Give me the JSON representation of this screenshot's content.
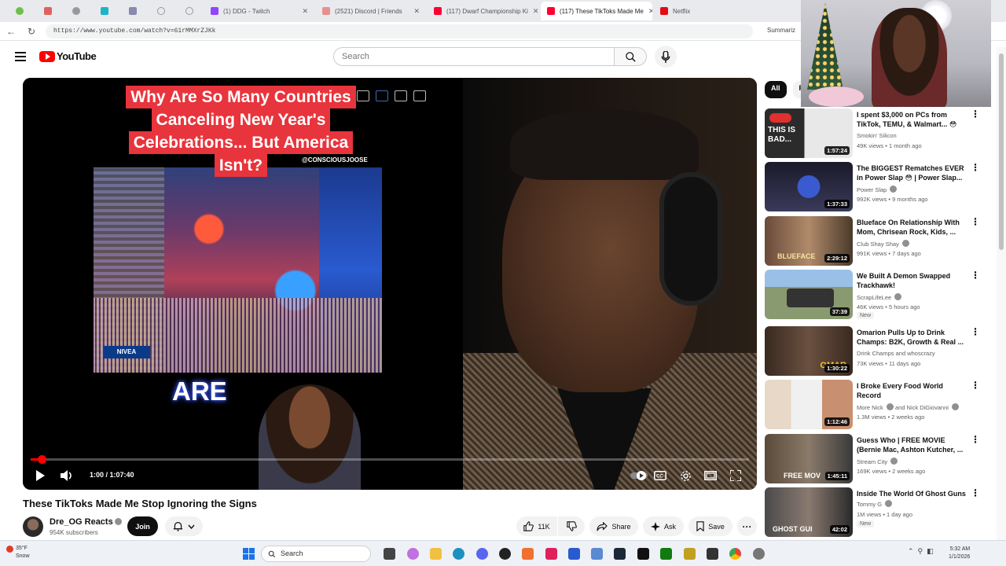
{
  "browser": {
    "tabs": [
      {
        "label": "(1) DDG - Twitch",
        "fav_color": "#9146ff"
      },
      {
        "label": "(2521) Discord | Friends",
        "fav_color": "#e8908e"
      },
      {
        "label": "(117) Dwarf Championship Ki",
        "fav_color": "#ff0033"
      },
      {
        "label": "(117) These TikToks Made Me",
        "fav_color": "#ff0033",
        "active": true
      },
      {
        "label": "Netflix",
        "fav_color": "#e50914"
      }
    ],
    "url": "https://www.youtube.com/watch?v=61rMMXrZJKk",
    "summarize": "Summariz"
  },
  "youtube": {
    "logo_text": "YouTube",
    "search_placeholder": "Search"
  },
  "player": {
    "overlay_caption": [
      "Why Are So Many Countries",
      "Canceling New Year's",
      "Celebrations... But America",
      "Isn't?"
    ],
    "overlay_handle": "@CONSCIOUSJOOSE",
    "overlay_word": "ARE",
    "sign_text": "NIVEA",
    "time_display": "1:00 / 1:07:40",
    "progress_fraction": 0.015
  },
  "video": {
    "title": "These TikToks Made Me Stop Ignoring the Signs",
    "channel": "Dre_OG Reacts",
    "subscribers": "954K subscribers",
    "join_label": "Join",
    "likes": "11K",
    "share_label": "Share",
    "ask_label": "Ask",
    "save_label": "Save"
  },
  "chips": [
    "All",
    "F"
  ],
  "recommendations": [
    {
      "title": "I spent $3,000 on PCs from TikTok, TEMU, & Walmart... 😳",
      "channel": "Smokin' Silicon",
      "meta": "49K views • 1 month ago",
      "duration": "1:57:24",
      "thumb_text": "THIS IS BAD...",
      "verified": false,
      "badge": ""
    },
    {
      "title": "The BIGGEST Rematches EVER in Power Slap 😳 | Power Slap...",
      "channel": "Power Slap",
      "meta": "992K views • 9 months ago",
      "duration": "1:37:33",
      "thumb_text": "",
      "verified": true,
      "badge": ""
    },
    {
      "title": "Blueface On Relationship With Mom, Chrisean Rock, Kids, ...",
      "channel": "Club Shay Shay",
      "meta": "991K views • 7 days ago",
      "duration": "2:29:12",
      "thumb_text": "BLUEFACE",
      "verified": true,
      "badge": ""
    },
    {
      "title": "We Built A Demon Swapped Trackhawk!",
      "channel": "ScrapLifeLee",
      "meta": "46K views • 5 hours ago",
      "duration": "37:39",
      "thumb_text": "",
      "verified": true,
      "badge": "New"
    },
    {
      "title": "Omarion Pulls Up to Drink Champs: B2K, Growth & Real ...",
      "channel": "Drink Champs and whoscrazy",
      "meta": "73K views • 11 days ago",
      "duration": "1:30:22",
      "thumb_text": "OMAR",
      "verified": false,
      "badge": ""
    },
    {
      "title": "I Broke Every Food World Record",
      "channel": "More Nick",
      "channel2": "and Nick DiGiovanni",
      "meta": "1.3M views • 2 weeks ago",
      "duration": "1:12:46",
      "thumb_text": "",
      "verified": true,
      "badge": ""
    },
    {
      "title": "Guess Who | FREE MOVIE (Bernie Mac, Ashton Kutcher, ...",
      "channel": "Stream City",
      "meta": "169K views • 2 weeks ago",
      "duration": "1:45:11",
      "thumb_text": "FREE MOV",
      "verified": true,
      "badge": ""
    },
    {
      "title": "Inside The World Of Ghost Guns",
      "channel": "Tommy G",
      "meta": "1M views • 1 day ago",
      "duration": "42:02",
      "thumb_text": "GHOST GUI",
      "verified": true,
      "badge": "New"
    }
  ],
  "taskbar": {
    "temp": "35°F",
    "condition": "Snow",
    "search_label": "Search",
    "time": "5:32 AM",
    "date": "1/1/2026"
  },
  "colors": {
    "yt_red": "#ff0000",
    "caption_red": "#e8343c",
    "chip_active": "#0f0f0f"
  }
}
